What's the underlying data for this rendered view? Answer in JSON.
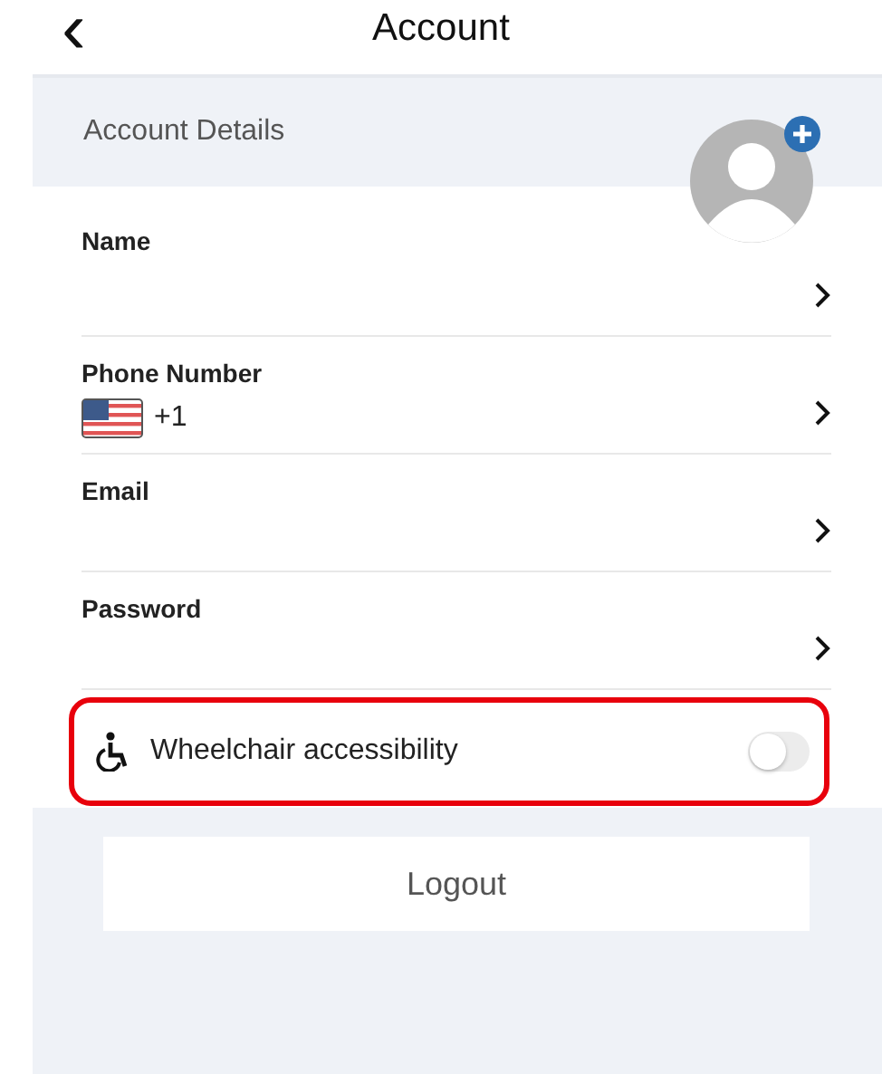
{
  "header": {
    "back_icon": "‹",
    "title": "Account"
  },
  "section": {
    "title": "Account Details"
  },
  "rows": [
    {
      "kind": "plain",
      "label": "Name"
    },
    {
      "kind": "phone",
      "label": "Phone Number",
      "value": "+1"
    },
    {
      "kind": "plain",
      "label": "Email"
    },
    {
      "kind": "plain",
      "label": "Password"
    }
  ],
  "accessibility": {
    "label": "Wheelchair accessibility",
    "on": false,
    "highlighted": true
  },
  "logout": {
    "label": "Logout"
  }
}
